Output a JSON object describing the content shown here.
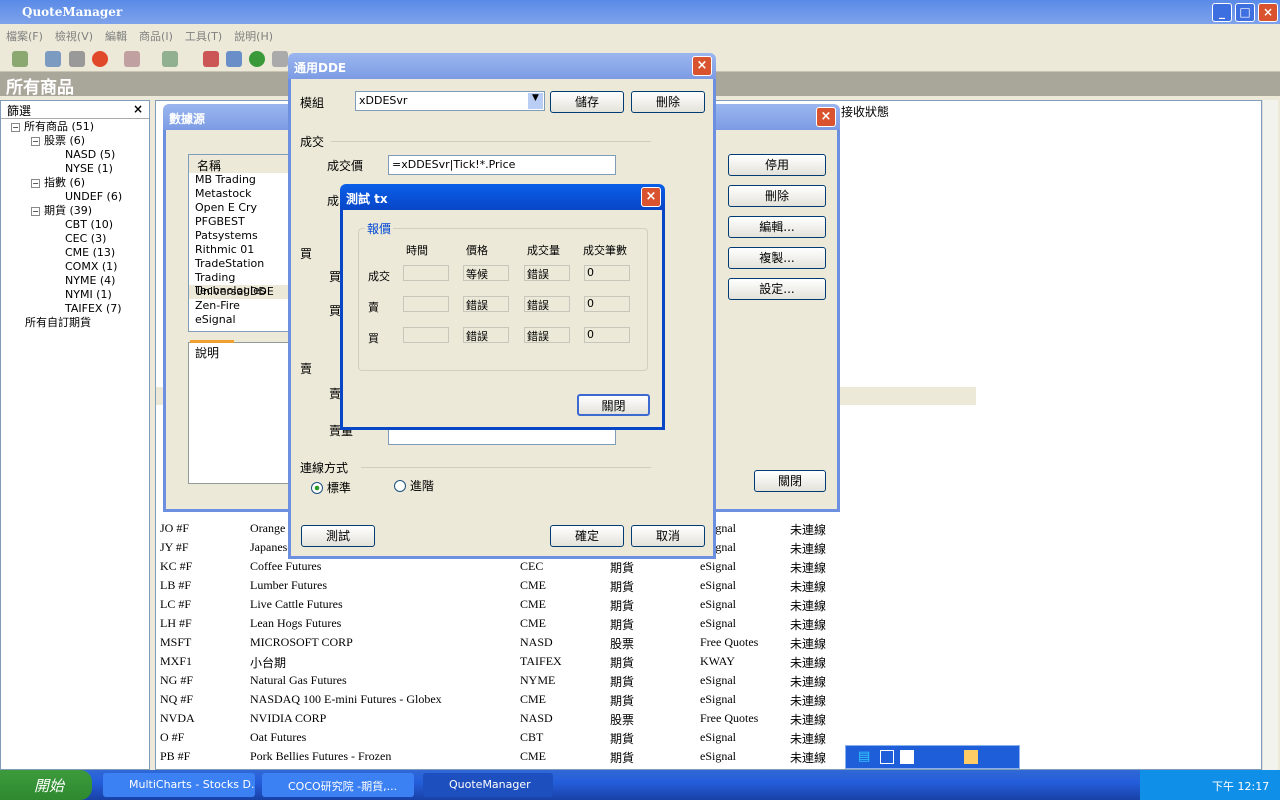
{
  "app": {
    "title": "QuoteManager"
  },
  "menu": [
    "檔案(F)",
    "檢視(V)",
    "編輯",
    "商品(I)",
    "工具(T)",
    "說明(H)"
  ],
  "header": {
    "title": "所有商品"
  },
  "filter": {
    "title": "篩選",
    "close": "×",
    "tree": [
      {
        "t": "所有商品 (51)",
        "l": 0,
        "e": "−"
      },
      {
        "t": "股票 (6)",
        "l": 1,
        "e": "−"
      },
      {
        "t": "NASD (5)",
        "l": 2
      },
      {
        "t": "NYSE (1)",
        "l": 2
      },
      {
        "t": "指數 (6)",
        "l": 1,
        "e": "−"
      },
      {
        "t": "UNDEF (6)",
        "l": 2
      },
      {
        "t": "期貨 (39)",
        "l": 1,
        "e": "−"
      },
      {
        "t": "CBT (10)",
        "l": 2
      },
      {
        "t": "CEC (3)",
        "l": 2
      },
      {
        "t": "CME (13)",
        "l": 2
      },
      {
        "t": "COMX (1)",
        "l": 2
      },
      {
        "t": "NYME (4)",
        "l": 2
      },
      {
        "t": "NYMI (1)",
        "l": 2
      },
      {
        "t": "TAIFEX (7)",
        "l": 2
      },
      {
        "t": "所有自訂期貨",
        "l": 0
      }
    ]
  },
  "grid": {
    "status_header": "接收狀態",
    "rows": [
      [
        "JO #F",
        "Orange",
        "",
        "",
        "eSignal",
        "未連線"
      ],
      [
        "JY #F",
        "Japanese",
        "",
        "",
        "eSignal",
        "未連線"
      ],
      [
        "KC #F",
        "Coffee Futures",
        "CEC",
        "期貨",
        "eSignal",
        "未連線"
      ],
      [
        "LB #F",
        "Lumber Futures",
        "CME",
        "期貨",
        "eSignal",
        "未連線"
      ],
      [
        "LC #F",
        "Live Cattle Futures",
        "CME",
        "期貨",
        "eSignal",
        "未連線"
      ],
      [
        "LH #F",
        "Lean Hogs Futures",
        "CME",
        "期貨",
        "eSignal",
        "未連線"
      ],
      [
        "MSFT",
        "MICROSOFT CORP",
        "NASD",
        "股票",
        "Free Quotes",
        "未連線"
      ],
      [
        "MXF1",
        "小台期",
        "TAIFEX",
        "期貨",
        "KWAY",
        "未連線"
      ],
      [
        "NG #F",
        "Natural Gas Futures",
        "NYME",
        "期貨",
        "eSignal",
        "未連線"
      ],
      [
        "NQ #F",
        "NASDAQ 100 E-mini Futures - Globex",
        "CME",
        "期貨",
        "eSignal",
        "未連線"
      ],
      [
        "NVDA",
        "NVIDIA CORP",
        "NASD",
        "股票",
        "Free Quotes",
        "未連線"
      ],
      [
        "O #F",
        "Oat Futures",
        "CBT",
        "期貨",
        "eSignal",
        "未連線"
      ],
      [
        "PB #F",
        "Pork Bellies Futures - Frozen",
        "CME",
        "期貨",
        "eSignal",
        "未連線"
      ]
    ]
  },
  "datasource": {
    "title": "數據源",
    "list_header": "名稱",
    "items": [
      "MB Trading",
      "Metastock",
      "Open E Cry",
      "PFGBEST",
      "Patsystems",
      "Rithmic 01",
      "TradeStation",
      "Trading Technologies",
      "Universal DDE",
      "Zen-Fire",
      "eSignal"
    ],
    "selected": "Universal DDE",
    "tab": "說明",
    "buttons": [
      "停用",
      "刪除",
      "編輯...",
      "複製...",
      "設定..."
    ],
    "close": "關閉"
  },
  "dde": {
    "title": "通用DDE",
    "module_label": "模組",
    "module_value": "xDDESvr",
    "save": "儲存",
    "delete": "刪除",
    "trade_section": "成交",
    "trade_price_label": "成交價",
    "trade_price_value": "=xDDESvr|Tick!*.Price",
    "trade_qty_label": "成",
    "buy_section": "買",
    "buy1": "買",
    "buy2": "買",
    "sell_section": "賣",
    "sell1": "賣",
    "sell_qty_label": "賣量",
    "conn_section": "連線方式",
    "radio_std": "標準",
    "radio_adv": "進階",
    "radio_selected": "標準",
    "test": "測試",
    "ok": "確定",
    "cancel": "取消"
  },
  "test": {
    "title": "測試 tx",
    "group": "報價",
    "cols": [
      "時間",
      "價格",
      "成交量",
      "成交筆數"
    ],
    "rows": [
      {
        "label": "成交",
        "vals": [
          "",
          "等候",
          "錯誤",
          "0"
        ]
      },
      {
        "label": "賣",
        "vals": [
          "",
          "錯誤",
          "錯誤",
          "0"
        ]
      },
      {
        "label": "買",
        "vals": [
          "",
          "錯誤",
          "錯誤",
          "0"
        ]
      }
    ],
    "close": "關閉"
  },
  "taskbar": {
    "start": "開始",
    "tasks": [
      "MultiCharts - Stocks D...",
      "COCO研究院 -期貨,...",
      "QuoteManager"
    ],
    "clock": "下午 12:17"
  }
}
